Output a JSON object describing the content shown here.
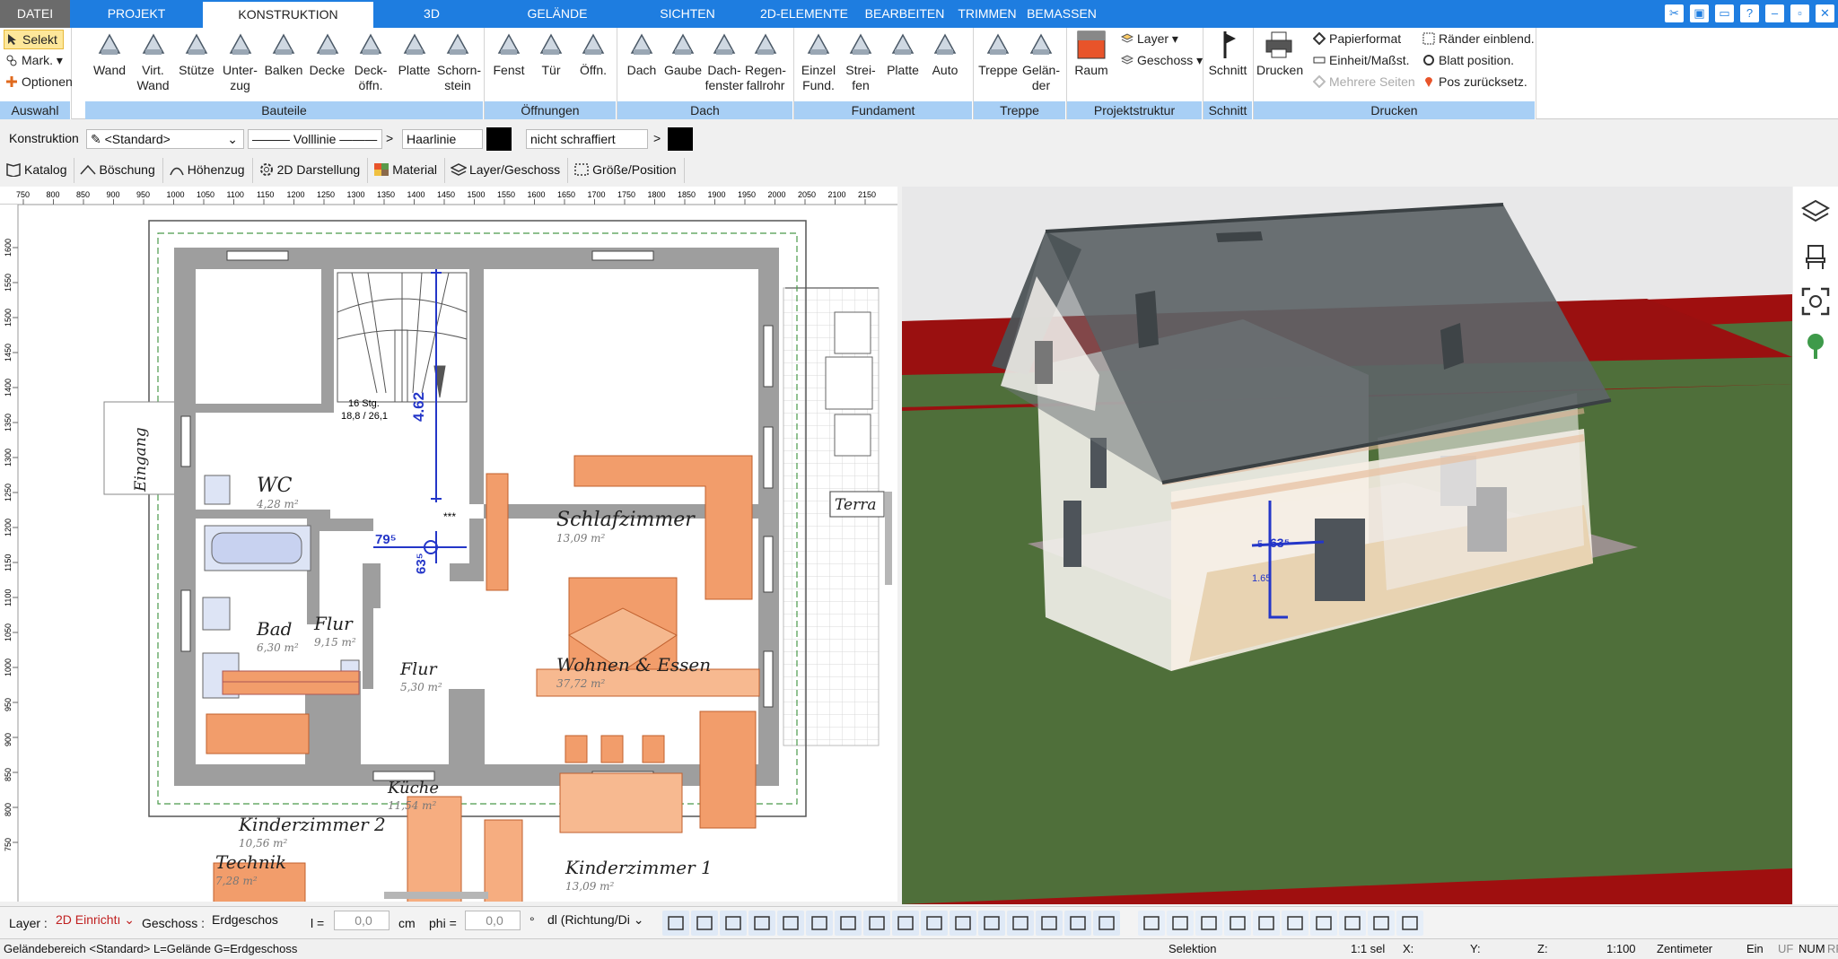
{
  "menu": {
    "tabs": [
      "DATEI",
      "PROJEKT",
      "KONSTRUKTION",
      "3D",
      "GELÄNDE",
      "SICHTEN",
      "2D-ELEMENTE",
      "BEARBEITEN",
      "TRIMMEN",
      "BEMASSEN"
    ],
    "active": "KONSTRUKTION",
    "window_controls": [
      "✂",
      "▣",
      "▭",
      "?",
      "–",
      "▫",
      "✕"
    ]
  },
  "ribbon": {
    "auswahl": {
      "label": "Auswahl",
      "selekt": "Selekt",
      "mark": "Mark.",
      "optionen": "Optionen"
    },
    "bauteile": {
      "label": "Bauteile",
      "items": [
        {
          "l1": "Wand",
          "l2": ""
        },
        {
          "l1": "Virt.",
          "l2": "Wand"
        },
        {
          "l1": "Stütze",
          "l2": ""
        },
        {
          "l1": "Unter-",
          "l2": "zug"
        },
        {
          "l1": "Balken",
          "l2": ""
        },
        {
          "l1": "Decke",
          "l2": ""
        },
        {
          "l1": "Deck-",
          "l2": "öffn."
        },
        {
          "l1": "Platte",
          "l2": ""
        },
        {
          "l1": "Schorn-",
          "l2": "stein"
        }
      ]
    },
    "oeffnungen": {
      "label": "Öffnungen",
      "items": [
        {
          "l1": "Fenst",
          "l2": ""
        },
        {
          "l1": "Tür",
          "l2": ""
        },
        {
          "l1": "Öffn.",
          "l2": ""
        }
      ]
    },
    "dach": {
      "label": "Dach",
      "items": [
        {
          "l1": "Dach",
          "l2": ""
        },
        {
          "l1": "Gaube",
          "l2": ""
        },
        {
          "l1": "Dach-",
          "l2": "fenster"
        },
        {
          "l1": "Regen-",
          "l2": "fallrohr"
        }
      ]
    },
    "fundament": {
      "label": "Fundament",
      "items": [
        {
          "l1": "Einzel",
          "l2": "Fund."
        },
        {
          "l1": "Strei-",
          "l2": "fen"
        },
        {
          "l1": "Platte",
          "l2": ""
        },
        {
          "l1": "Auto",
          "l2": ""
        }
      ]
    },
    "treppe": {
      "label": "Treppe",
      "items": [
        {
          "l1": "Treppe",
          "l2": ""
        },
        {
          "l1": "Gelän-",
          "l2": "der"
        }
      ]
    },
    "projektstruktur": {
      "label": "Projektstruktur",
      "raum": "Raum",
      "layer": "Layer",
      "geschoss": "Geschoss"
    },
    "schnitt": {
      "label": "Schnitt",
      "item": "Schnitt"
    },
    "drucken": {
      "label": "Drucken",
      "drucken": "Drucken",
      "papierformat": "Papierformat",
      "einheit": "Einheit/Maßst.",
      "mehrere": "Mehrere Seiten",
      "raender": "Ränder einblend.",
      "blatt": "Blatt position.",
      "pos": "Pos zurücksetz."
    }
  },
  "props": {
    "konstruktion": "Konstruktion",
    "standard": "<Standard>",
    "linie": "——— Volllinie ———",
    "haarlinie": "Haarlinie",
    "schraffur": "nicht schraffiert",
    "arrow": ">"
  },
  "toolbar2": [
    "Katalog",
    "Böschung",
    "Höhenzug",
    "2D Darstellung",
    "Material",
    "Layer/Geschoss",
    "Größe/Position"
  ],
  "ruler": {
    "x": [
      "750",
      "800",
      "850",
      "900",
      "950",
      "1000",
      "1050",
      "1100",
      "1150",
      "1200",
      "1250",
      "1300",
      "1350",
      "1400",
      "1450",
      "1500",
      "1550",
      "1600",
      "1650",
      "1700",
      "1750",
      "1800",
      "1850",
      "1900",
      "1950",
      "2000",
      "2050",
      "2100",
      "2150"
    ],
    "y": [
      "1600",
      "1550",
      "1500",
      "1450",
      "1400",
      "1350",
      "1300",
      "1250",
      "1200",
      "1150",
      "1100",
      "1050",
      "1000",
      "950",
      "900",
      "850",
      "800",
      "750"
    ]
  },
  "plan": {
    "rooms": [
      {
        "name": "WC",
        "area": "4,28 m²"
      },
      {
        "name": "Schlafzimmer",
        "area": "13,09 m²"
      },
      {
        "name": "Bad",
        "area": "6,30 m²"
      },
      {
        "name": "Flur",
        "area": "9,15 m²"
      },
      {
        "name": "Flur",
        "area": "5,30 m²"
      },
      {
        "name": "Wohnen & Essen",
        "area": "37,72 m²"
      },
      {
        "name": "Küche",
        "area": "11,54 m²"
      },
      {
        "name": "Kinderzimmer 2",
        "area": "10,56 m²"
      },
      {
        "name": "Technik",
        "area": "7,28 m²"
      },
      {
        "name": "Kinderzimmer 1",
        "area": "13,09 m²"
      }
    ],
    "eingang": "Eingang",
    "terrasse": "Terra",
    "stair_steps": "16 Stg.",
    "stair_dims": "18,8 / 26,1",
    "dim1": "4.62",
    "dim2": "79⁵",
    "dim3": "63⁵",
    "stars": "***"
  },
  "view3d": {
    "dim_a": "63⁵",
    "dim_b": "1.65",
    "dim_c": "5"
  },
  "bottom": {
    "layer_label": "Layer :",
    "layer_value": "2D Einrichtı",
    "geschoss_label": "Geschoss :",
    "geschoss_value": "Erdgeschos",
    "l_label": "l =",
    "l_value": "0,0",
    "l_unit": "cm",
    "phi_label": "phi =",
    "phi_value": "0,0",
    "phi_unit": "°",
    "dl_value": "dl (Richtung/Di"
  },
  "status": {
    "left": "Geländebereich <Standard> L=Gelände G=Erdgeschoss",
    "mode": "Selektion",
    "sel": "1:1 sel",
    "x": "X:",
    "y": "Y:",
    "z": "Z:",
    "scale": "1:100",
    "unit": "Zentimeter",
    "ein": "Ein",
    "uf": "UF",
    "num": "NUM",
    "rf": "RF"
  },
  "colors": {
    "accent": "#1e7de0",
    "ribbon_group": "#a8cff5",
    "furniture": "#f29d6b",
    "wall": "#9e9e9e",
    "lawn": "#4f6f3a",
    "border": "#9f0f0f"
  }
}
